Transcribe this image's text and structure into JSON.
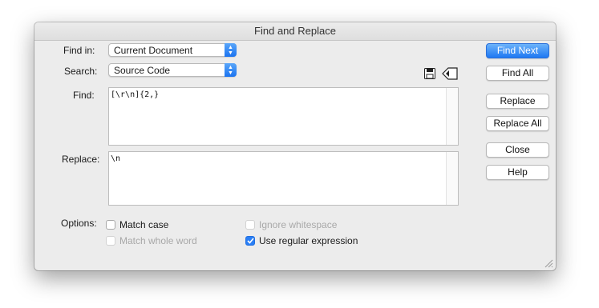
{
  "window": {
    "title": "Find and Replace"
  },
  "find_in": {
    "label": "Find in:",
    "value": "Current Document"
  },
  "search": {
    "label": "Search:",
    "value": "Source Code"
  },
  "find": {
    "label": "Find:",
    "value": "[\\r\\n]{2,}"
  },
  "replace": {
    "label": "Replace:",
    "value": "\\n"
  },
  "options": {
    "label": "Options:",
    "match_case": {
      "label": "Match case",
      "checked": false,
      "enabled": true
    },
    "match_whole_word": {
      "label": "Match whole word",
      "checked": false,
      "enabled": false
    },
    "ignore_whitespace": {
      "label": "Ignore whitespace",
      "checked": false,
      "enabled": false
    },
    "use_regex": {
      "label": "Use regular expression",
      "checked": true,
      "enabled": true
    }
  },
  "buttons": {
    "find_next": "Find Next",
    "find_all": "Find All",
    "replace": "Replace",
    "replace_all": "Replace All",
    "close": "Close",
    "help": "Help"
  },
  "icons": {
    "save": "save-icon",
    "load": "load-query-icon",
    "grip": "resize-grip-icon"
  },
  "colors": {
    "accent": "#1f78f2"
  }
}
